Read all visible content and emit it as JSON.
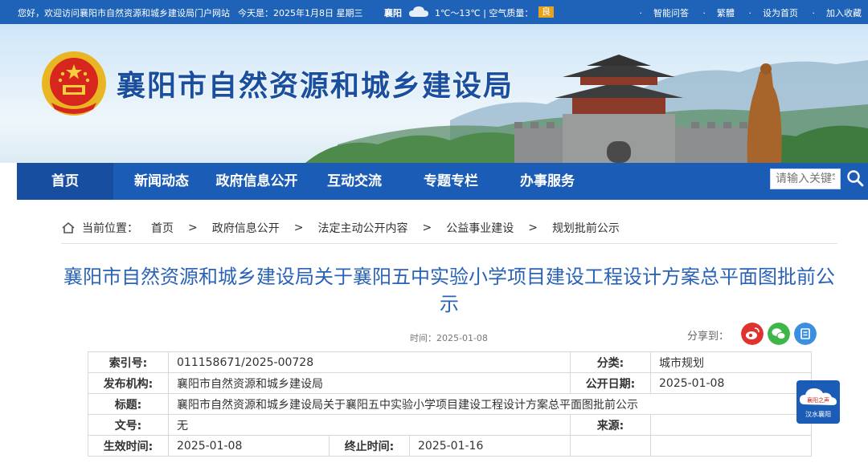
{
  "topbar": {
    "welcome": "您好，欢迎访问襄阳市自然资源和城乡建设局门户网站",
    "date": "今天是：2025年1月8日 星期三",
    "city": "襄阳",
    "temperature": "1℃～13℃",
    "air_quality_label": "空气质量：",
    "air_quality_value": "良",
    "links": [
      "智能问答",
      "繁體",
      "设为首页",
      "加入收藏"
    ]
  },
  "banner": {
    "site_title": "襄阳市自然资源和城乡建设局",
    "gate_sign": "门楼"
  },
  "nav": {
    "items": [
      "首页",
      "新闻动态",
      "政府信息公开",
      "互动交流",
      "专题专栏",
      "办事服务"
    ],
    "search_placeholder": "请输入关键字"
  },
  "breadcrumb": {
    "label": "当前位置：",
    "items": [
      "首页",
      "政府信息公开",
      "法定主动公开内容",
      "公益事业建设",
      "规划批前公示"
    ],
    "separator": ">"
  },
  "article": {
    "title": "襄阳市自然资源和城乡建设局关于襄阳五中实验小学项目建设工程设计方案总平面图批前公示",
    "time": "时间：2025-01-08",
    "share_label": "分享到："
  },
  "meta": {
    "index_no_label": "索引号:",
    "index_no": "011158671/2025-00728",
    "category_label": "分类:",
    "category": "城市规划",
    "publisher_label": "发布机构:",
    "publisher": "襄阳市自然资源和城乡建设局",
    "pub_date_label": "公开日期:",
    "pub_date": "2025-01-08",
    "title_label": "标题:",
    "title": "襄阳市自然资源和城乡建设局关于襄阳五中实验小学项目建设工程设计方案总平面图批前公示",
    "doc_no_label": "文号:",
    "doc_no": "无",
    "source_label": "来源:",
    "source": "",
    "effective_label": "生效时间:",
    "effective": "2025-01-08",
    "end_label": "终止时间:",
    "end": "2025-01-16"
  },
  "float_badge": {
    "line1": "襄阳之声",
    "line2": "汉水襄阳"
  },
  "colors": {
    "primary_blue": "#1b5cb6",
    "title_blue": "#2a63b6",
    "air_quality": "#e8a21c",
    "weibo_red": "#e0332f",
    "wechat_green": "#3fb64a",
    "share_blue": "#3b8fe0"
  }
}
